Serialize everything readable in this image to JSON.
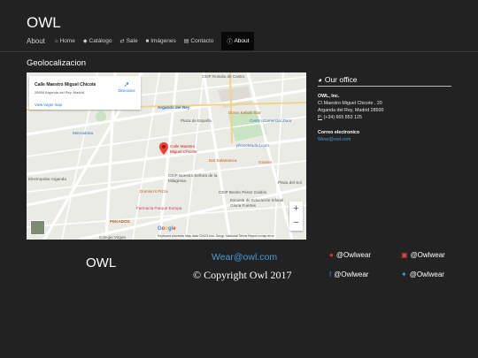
{
  "brand": "OWL",
  "nav": {
    "items": [
      {
        "label": "About",
        "icon": ""
      },
      {
        "label": "Home",
        "icon": "home-icon"
      },
      {
        "label": "Catálogo",
        "icon": "tag-icon"
      },
      {
        "label": "Sale",
        "icon": "exchange-icon"
      },
      {
        "label": "Imágenes",
        "icon": "camera-icon"
      },
      {
        "label": "Contacto",
        "icon": "address-card-icon"
      },
      {
        "label": "About",
        "icon": "info-icon"
      }
    ]
  },
  "section_title": "Geolocalizacion",
  "map": {
    "card_title": "Calle Maestro Miguel Chicote",
    "card_address": "28500 Arganda del Rey, Madrid",
    "card_link": "View larger map",
    "directions": "Directions",
    "pin_label_1": "Calle Maestro",
    "pin_label_2": "Miguel Chicote",
    "places": {
      "ceip": "CEIP Rosalia de Castro",
      "arganda": "Arganda del Rey",
      "doner": "Doner Kebab Star",
      "plaza": "Plaza de España",
      "centro": "Centro Comercial Zoco",
      "mercadona": "Mercadona",
      "phone": "phoneMadrid.com",
      "bar": "Bar Salamanca",
      "granier": "Granier",
      "electro": "Electropolar Arganda",
      "ceip_nuestra": "CEIP Nuestra Señora de la Milagrosa",
      "plaza_sol": "Plaza del Sol",
      "dominos": "Domino's Pizza",
      "ceip_benito": "CEIP Benito Pérez Galdós",
      "escuela": "Escuela de Educación Infantil Gloria Fuertes",
      "farmacia": "Farmacia Parque Europa",
      "pekados": "PEKADOS",
      "tiem": "Tiem",
      "colegio": "Colegio Virgen"
    },
    "zoom_in": "+",
    "zoom_out": "−",
    "google": "Google",
    "attribution": "Keyboard shortcuts   Map data ©2023 Inst. Geogr. Nacional   Terms   Report a map error"
  },
  "office": {
    "title": "Our office",
    "company": "OWL, Inc.",
    "street": "C\\ Maestro Miguel Chicote , 20",
    "city": "Arganda del Rey, Madrid 28500",
    "phone_prefix": "P:",
    "phone": "(+34) 665 853 125",
    "email_heading": "Correo electronico",
    "email": "Wear@owl.com"
  },
  "footer": {
    "brand": "OWL",
    "email": "Wear@owl.com",
    "copyright": "© Copyright Owl 2017",
    "socials": [
      {
        "icon": "pinterest-icon",
        "handle": "@Owlwear",
        "color": "#e03232"
      },
      {
        "icon": "instagram-icon",
        "handle": "@Owlwear",
        "color": "#e04848"
      },
      {
        "icon": "facebook-icon",
        "handle": "@Owlwear",
        "color": "#3b7bd6"
      },
      {
        "icon": "twitter-icon",
        "handle": "@Owlwear",
        "color": "#3ea6e8"
      }
    ]
  },
  "colors": {
    "background": "#222222",
    "link": "#4d9bd6",
    "active_nav": "#080808"
  }
}
